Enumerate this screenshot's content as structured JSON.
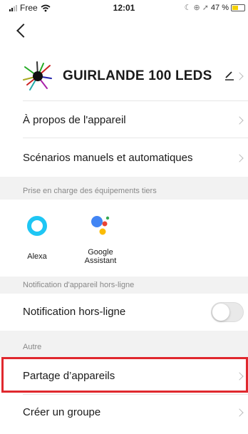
{
  "status_bar": {
    "carrier": "Free",
    "time": "12:01",
    "battery_percent": "47 %",
    "battery_level": 0.47
  },
  "device": {
    "name": "GUIRLANDE 100 LEDS"
  },
  "menu": {
    "about": "À propos de l'appareil",
    "scenarios": "Scénarios manuels et automatiques"
  },
  "third_party": {
    "header": "Prise en charge des équipements tiers",
    "alexa": "Alexa",
    "google_line1": "Google",
    "google_line2": "Assistant"
  },
  "offline": {
    "header": "Notification d'appareil hors-ligne",
    "label": "Notification hors-ligne",
    "enabled": false
  },
  "other": {
    "header": "Autre",
    "share": "Partage d’appareils",
    "create_group": "Créer un groupe"
  },
  "colors": {
    "highlight": "#e0282e",
    "alexa": "#1ec6f4"
  }
}
